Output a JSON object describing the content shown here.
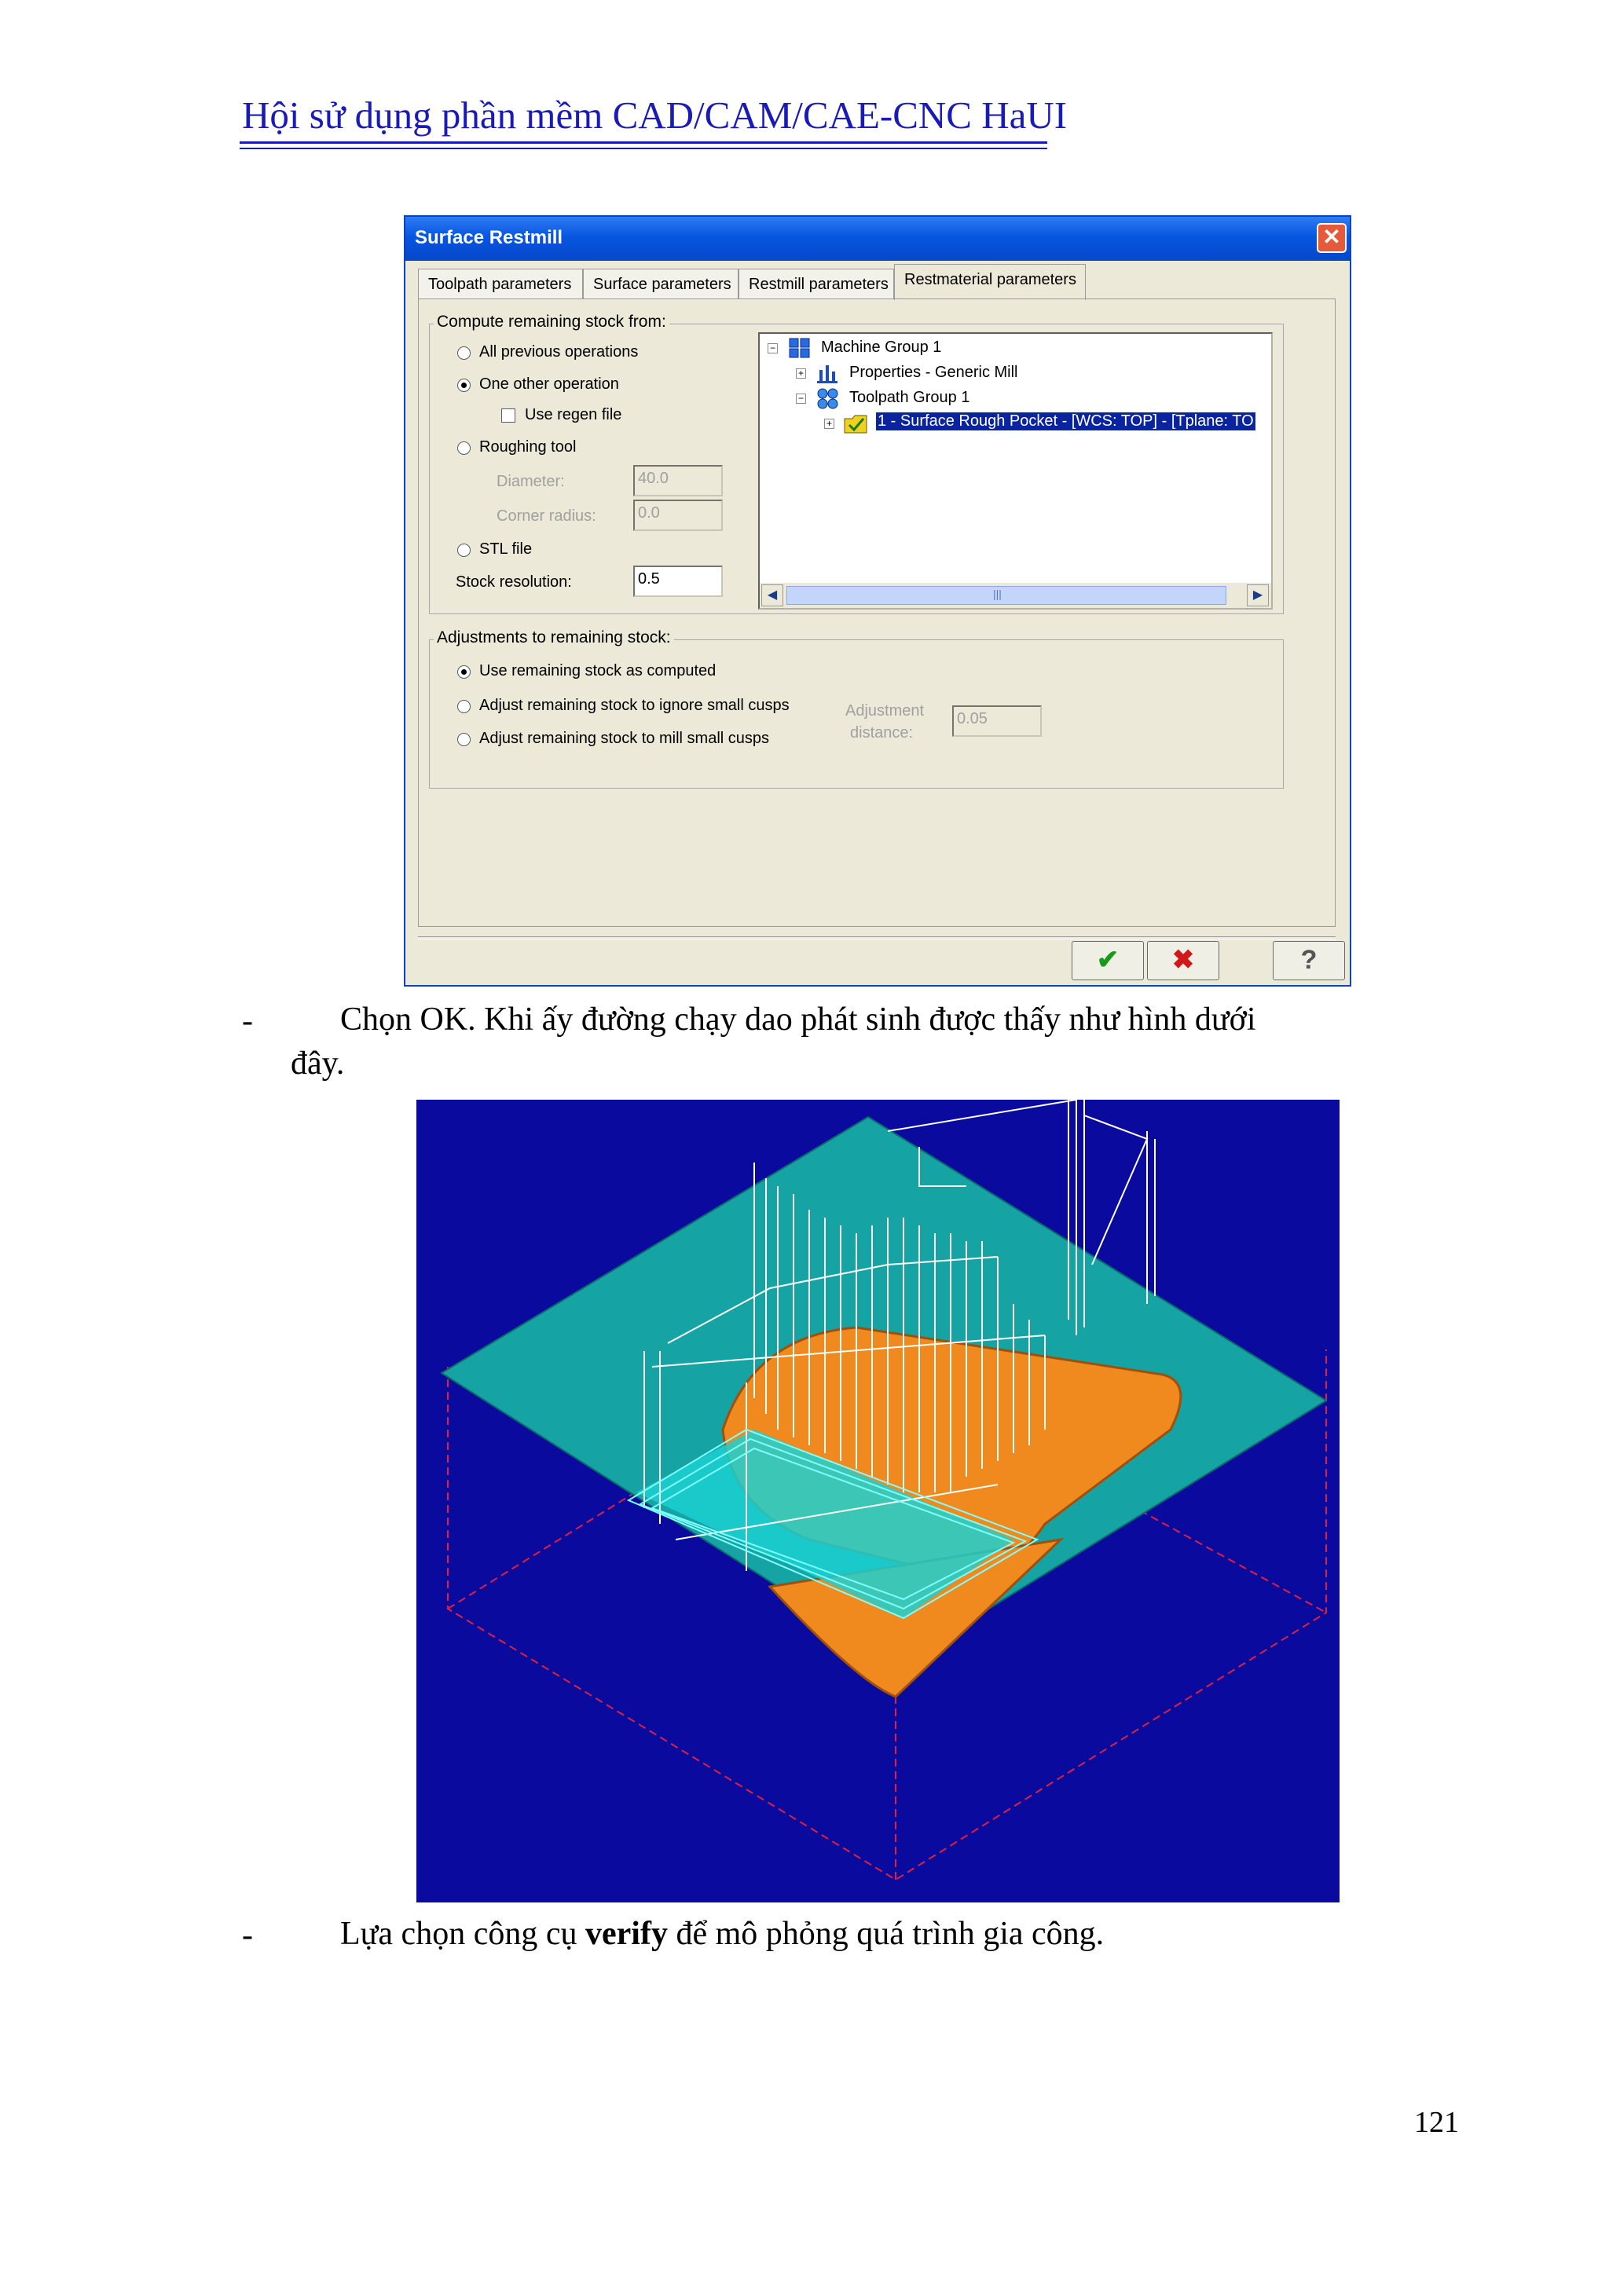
{
  "header": {
    "title": "Hội sử dụng phần mềm CAD/CAM/CAE-CNC HaUI"
  },
  "dialog": {
    "title": "Surface Restmill",
    "tabs": [
      "Toolpath parameters",
      "Surface parameters",
      "Restmill parameters",
      "Restmaterial parameters"
    ],
    "compute_group": {
      "label": "Compute remaining stock from:",
      "all_previous": "All previous operations",
      "one_other": "One other operation",
      "use_regen": "Use regen file",
      "roughing_tool": "Roughing tool",
      "diameter_label": "Diameter:",
      "diameter_value": "40.0",
      "corner_label": "Corner radius:",
      "corner_value": "0.0",
      "stl_file": "STL file",
      "stock_res_label": "Stock resolution:",
      "stock_res_value": "0.5",
      "selected": "One other operation"
    },
    "tree": {
      "machine_group": "Machine Group 1",
      "properties": "Properties - Generic Mill",
      "toolpath_group": "Toolpath Group 1",
      "operation": "1 - Surface Rough Pocket - [WCS: TOP] - [Tplane: TO",
      "scroll_grip": "|||"
    },
    "adjust_group": {
      "label": "Adjustments to remaining stock:",
      "use_computed": "Use remaining stock as computed",
      "ignore_cusps": "Adjust remaining stock to ignore small cusps",
      "mill_cusps": "Adjust remaining stock to mill small cusps",
      "adj_label_1": "Adjustment",
      "adj_label_2": "distance:",
      "adj_value": "0.05",
      "selected": "Use remaining stock as computed"
    },
    "buttons": {
      "ok": "✔",
      "cancel": "✖",
      "help": "?"
    }
  },
  "body": {
    "bullet": "-",
    "para1_line1": "Chọn OK. Khi ấy đường chạy dao phát sinh được thấy như hình dưới",
    "para1_line2": "đây.",
    "para2_pre": "Lựa chọn công cụ ",
    "para2_bold": "verify",
    "para2_post": " để mô phỏng quá trình gia công."
  },
  "cam_view": {
    "background": "#0a0a9e",
    "stock_color": "#19a0a0",
    "part_color": "#f08a1e",
    "toolpath_color": "#ffffff",
    "box_color": "#e02040"
  },
  "page_number": "121"
}
